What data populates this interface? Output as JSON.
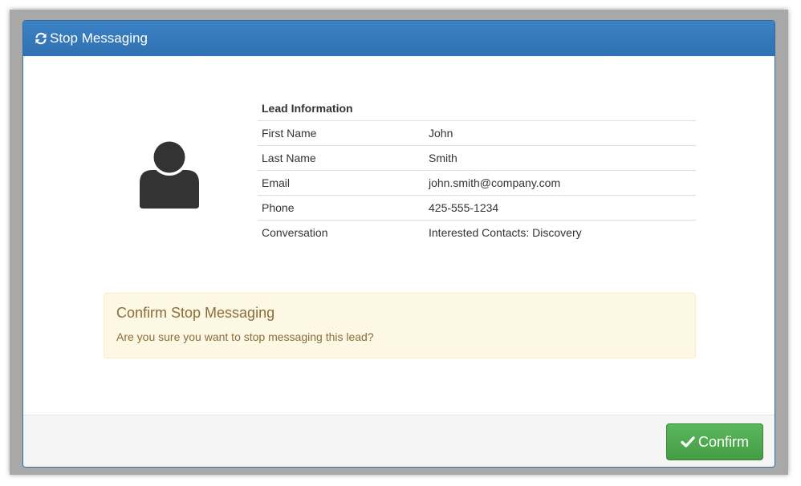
{
  "modal": {
    "title": "Stop Messaging",
    "header_icon": "refresh-icon",
    "header_color": "#337ab7"
  },
  "lead": {
    "heading": "Lead Information",
    "avatar_icon": "user-icon",
    "rows": [
      {
        "label": "First Name",
        "value": "John"
      },
      {
        "label": "Last Name",
        "value": "Smith"
      },
      {
        "label": "Email",
        "value": "john.smith@company.com"
      },
      {
        "label": "Phone",
        "value": "425-555-1234"
      },
      {
        "label": "Conversation",
        "value": "Interested Contacts: Discovery"
      }
    ]
  },
  "alert": {
    "title": "Confirm Stop Messaging",
    "message": "Are you sure you want to stop messaging this lead?",
    "color": "#8a6d3b",
    "background": "#fcf8e3"
  },
  "footer": {
    "confirm_label": "Confirm",
    "confirm_icon": "check-icon",
    "confirm_color": "#5cb85c"
  }
}
